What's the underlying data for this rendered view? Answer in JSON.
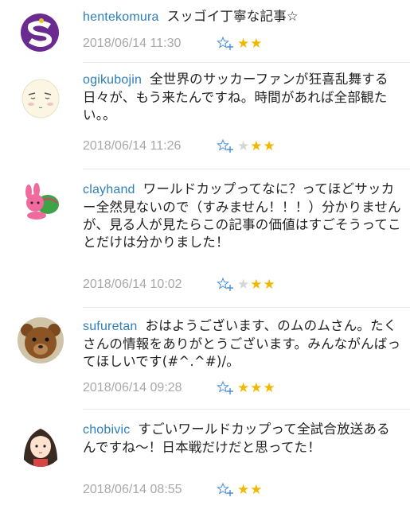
{
  "comments": [
    {
      "user": "hentekomura",
      "text": "スッゴイ丁寧な記事☆",
      "timestamp": "2018/06/14 11:30",
      "stars": [
        true,
        true
      ],
      "avatar": "purple-s-logo"
    },
    {
      "user": "ogikubojin",
      "text": "全世界のサッカーファンが狂喜乱舞する日々が、もう来たんですね。時間があれば全部観たい。。",
      "timestamp": "2018/06/14 11:26",
      "stars": [
        false,
        true,
        true
      ],
      "avatar": "face-drawing"
    },
    {
      "user": "clayhand",
      "text": "ワールドカップってなに？ってほどサッカー全然見ないので（すみません！！！）分かりませんが、見る人が見たらこの記事の価値はすごそうってことだけは分かりました！",
      "timestamp": "2018/06/14 10:02",
      "stars": [
        false,
        true,
        true
      ],
      "avatar": "rabbit-illustration"
    },
    {
      "user": "sufuretan",
      "text": "おはようございます、のムのムさん。たくさんの情報をありがとうございます。みんながんばってほしいです(#^.^#)/。",
      "timestamp": "2018/06/14 09:28",
      "stars": [
        true,
        true,
        true
      ],
      "avatar": "teddy-bear-photo"
    },
    {
      "user": "chobivic",
      "text": "すごいワールドカップって全試合放送あるんですね～！日本戦だけだと思ってた！",
      "timestamp": "2018/06/14 08:55",
      "stars": [
        true,
        true
      ],
      "avatar": "girl-illustration"
    }
  ],
  "colors": {
    "username": "#2f7fb8",
    "timestamp": "#a8a8a8",
    "star_on": "#f2b800",
    "star_off": "#d6d6d6",
    "add_star": "#4a90d9"
  },
  "icons": {
    "add_star": "star-plus-icon",
    "star": "star-icon"
  }
}
